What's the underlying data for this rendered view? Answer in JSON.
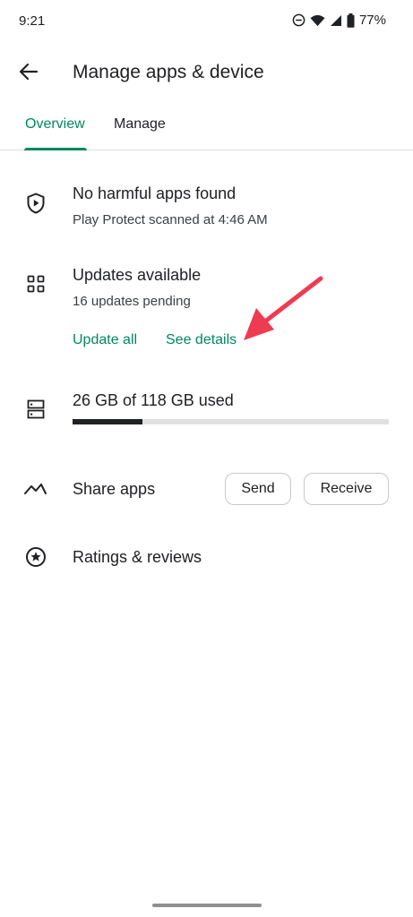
{
  "status_bar": {
    "time": "9:21",
    "battery": "77%",
    "icons": [
      "dnd-icon",
      "wifi-icon",
      "signal-icon",
      "battery-icon"
    ]
  },
  "app_bar": {
    "title": "Manage apps & device",
    "back_icon": "arrow-back-icon"
  },
  "tabs": [
    {
      "label": "Overview",
      "selected": true
    },
    {
      "label": "Manage",
      "selected": false
    }
  ],
  "protect": {
    "icon": "shield-play-icon",
    "title": "No harmful apps found",
    "subtitle": "Play Protect scanned at 4:46 AM"
  },
  "updates": {
    "icon": "apps-grid-icon",
    "title": "Updates available",
    "subtitle": "16 updates pending",
    "update_all_label": "Update all",
    "see_details_label": "See details"
  },
  "storage": {
    "icon": "storage-icon",
    "text": "26 GB of 118 GB used",
    "used_fraction": 0.22
  },
  "share": {
    "icon": "share-apps-icon",
    "label": "Share apps",
    "send_label": "Send",
    "receive_label": "Receive"
  },
  "ratings": {
    "icon": "star-circle-icon",
    "label": "Ratings & reviews"
  },
  "colors": {
    "accent": "#01875f",
    "annotation_arrow": "#ef3b52"
  }
}
